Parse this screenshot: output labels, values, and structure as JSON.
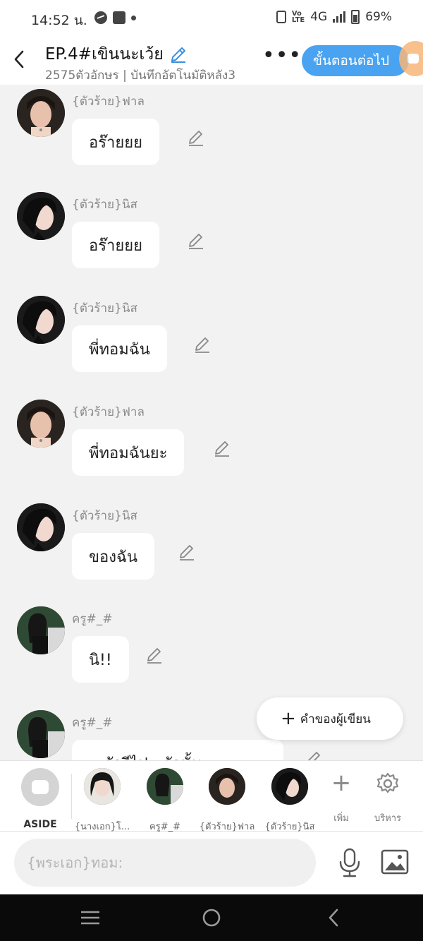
{
  "status_bar": {
    "time": "14:52 น.",
    "network": "4G",
    "battery": "69%"
  },
  "header": {
    "title": "EP.4#เขินนะเว้ย",
    "subtitle": "2575ตัวอักษร | บันทึกอัตโนมัติหลัง3",
    "more_label": "•••",
    "next_label": "ขั้นตอนต่อไป"
  },
  "messages": [
    {
      "speaker": "{ตัวร้าย}ฟาล",
      "text": "อร๊ายยย",
      "avatar": "fal-avatar"
    },
    {
      "speaker": "{ตัวร้าย}นิส",
      "text": "อร๊ายยย",
      "avatar": "nis-avatar"
    },
    {
      "speaker": "{ตัวร้าย}นิส",
      "text": "พี่ทอมฉัน",
      "avatar": "nis-avatar"
    },
    {
      "speaker": "{ตัวร้าย}ฟาล",
      "text": "พี่ทอมฉันยะ",
      "avatar": "fal-avatar"
    },
    {
      "speaker": "{ตัวร้าย}นิส",
      "text": "ของฉัน",
      "avatar": "nis-avatar"
    },
    {
      "speaker": "ครู#_#",
      "text": "นิ!!",
      "avatar": "teacher-avatar"
    },
    {
      "speaker": "ครู#_#",
      "text": "...ลัวรีไป...ลัวนั้น...",
      "avatar": "teacher-avatar"
    }
  ],
  "writer_note": {
    "label": "คำของผู้เขียน"
  },
  "character_bar": {
    "aside_label": "ASIDE",
    "characters": [
      {
        "label": "{นางเอก}โ..."
      },
      {
        "label": "ครู#_#"
      },
      {
        "label": "{ตัวร้าย}ฟาล"
      },
      {
        "label": "{ตัวร้าย}นิส"
      }
    ],
    "add_label": "เพิ่ม",
    "manage_label": "บริหาร"
  },
  "input": {
    "placeholder": "{พระเอก}ทอม:"
  }
}
